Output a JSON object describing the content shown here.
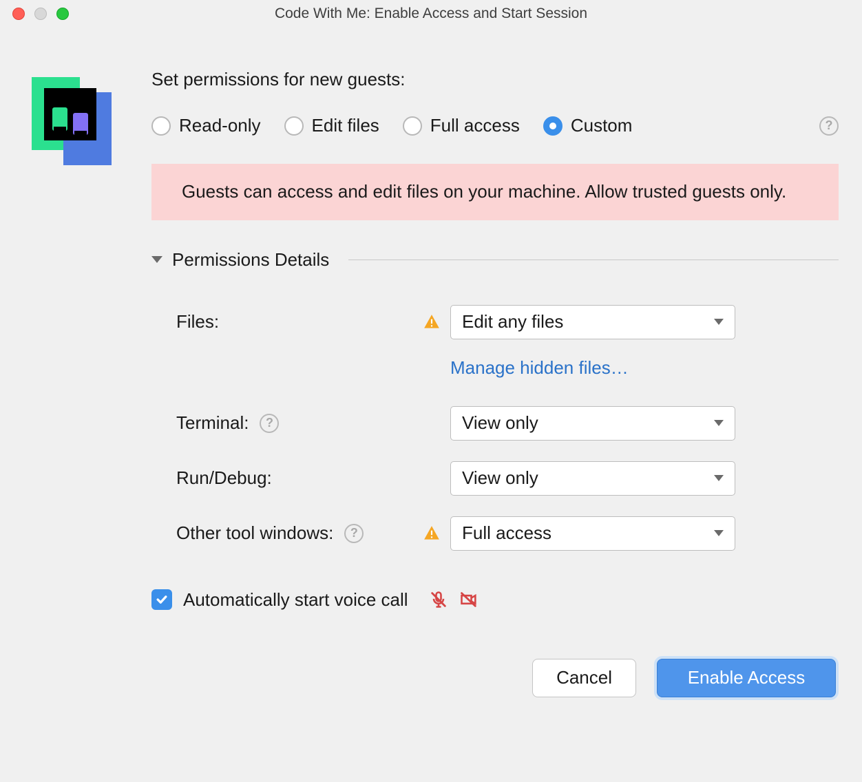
{
  "window": {
    "title": "Code With Me: Enable Access and Start Session"
  },
  "heading": "Set permissions for new guests:",
  "radios": {
    "read_only": "Read-only",
    "edit_files": "Edit files",
    "full_access": "Full access",
    "custom": "Custom"
  },
  "warning": "Guests can access and edit files on your machine. Allow trusted guests only.",
  "section_title": "Permissions Details",
  "permissions": {
    "files": {
      "label": "Files:",
      "value": "Edit any files"
    },
    "manage_hidden": "Manage hidden files…",
    "terminal": {
      "label": "Terminal:",
      "value": "View only"
    },
    "run_debug": {
      "label": "Run/Debug:",
      "value": "View only"
    },
    "other_tools": {
      "label": "Other tool windows:",
      "value": "Full access"
    }
  },
  "voice_call": {
    "label": "Automatically start voice call",
    "checked": true
  },
  "buttons": {
    "cancel": "Cancel",
    "enable": "Enable Access"
  }
}
